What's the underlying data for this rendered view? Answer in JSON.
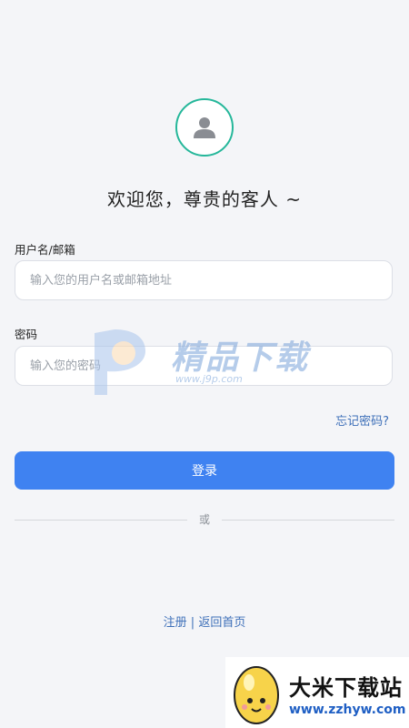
{
  "header": {
    "avatar_icon": "user-icon",
    "title": "欢迎您，尊贵的客人 ~"
  },
  "form": {
    "username_label": "用户名/邮箱",
    "username_placeholder": "输入您的用户名或邮箱地址",
    "password_label": "密码",
    "password_placeholder": "输入您的密码",
    "forgot_label": "忘记密码?",
    "login_label": "登录",
    "divider_text": "或"
  },
  "footer": {
    "register_label": "注册",
    "separator": "|",
    "back_home_label": "返回首页"
  },
  "watermarks": {
    "center_text": "精品下载",
    "center_url": "www.j9p.com",
    "corner_text": "大米下载站",
    "corner_url": "www.zzhyw.com"
  },
  "colors": {
    "accent": "#3f82f1",
    "avatar_ring": "#25b79a",
    "link": "#3d6fb8",
    "background": "#f4f5f8"
  }
}
